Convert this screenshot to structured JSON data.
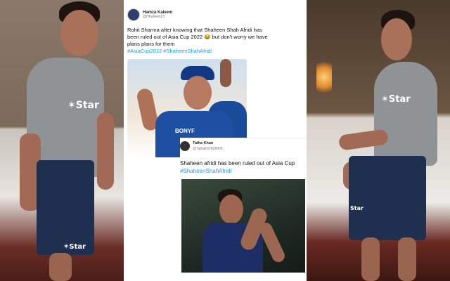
{
  "tweet": {
    "author_name": "Hamza Kaleem",
    "author_handle": "@HKaleem23",
    "text": "Rohit Sharma after knowing that Shaheen Shah Afridi has been ruled out of Asia Cup 2022 😂 but don't worry we have plans plans for them",
    "hashtags": "#AsiaCup2022 #ShaheenShahAfridi"
  },
  "quoted_tweet": {
    "author_name": "Talha Khan",
    "author_handle": "@TalhaK67828905",
    "text": "Shaheen afridi has been ruled out of Asia Cup",
    "hashtags": "#ShaheenShahAfridi"
  },
  "shirt_logo_left": "✶Star",
  "shorts_logo_left": "✶Star",
  "shirt_logo_right": "✶Star",
  "shorts_logo_right": "Star",
  "sponsor_text": "BONYF"
}
